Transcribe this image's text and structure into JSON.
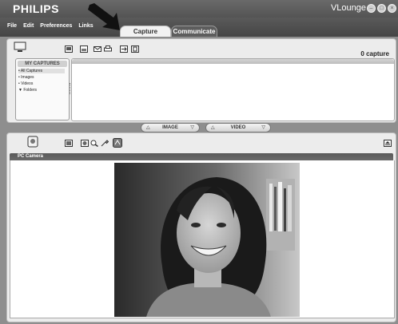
{
  "window": {
    "brand": "PHILIPS",
    "app_title": "VLounge"
  },
  "menu": {
    "items": [
      "File",
      "Edit",
      "Preferences",
      "Links"
    ]
  },
  "tabs": {
    "capture": "Capture",
    "communicate": "Communicate"
  },
  "captures": {
    "count_label": "0 capture",
    "sidebar_title": "MY CAPTURES",
    "items": [
      "All Captures",
      "Images",
      "Videos",
      "Folders"
    ]
  },
  "modes": {
    "image": "IMAGE",
    "video": "VIDEO"
  },
  "camera": {
    "label": "PC Camera"
  },
  "icons": {
    "title_controls": [
      "minimize-icon",
      "maximize-icon",
      "close-icon"
    ],
    "capture_toolbar": [
      "monitor-icon",
      "image-capture-icon",
      "save-icon",
      "email-icon",
      "print-icon",
      "export-icon",
      "trash-icon"
    ],
    "camera_toolbar": [
      "webcam-icon",
      "snapshot-icon",
      "photo-icon",
      "zoom-icon",
      "settings-icon",
      "effects-icon",
      "eject-icon"
    ]
  }
}
